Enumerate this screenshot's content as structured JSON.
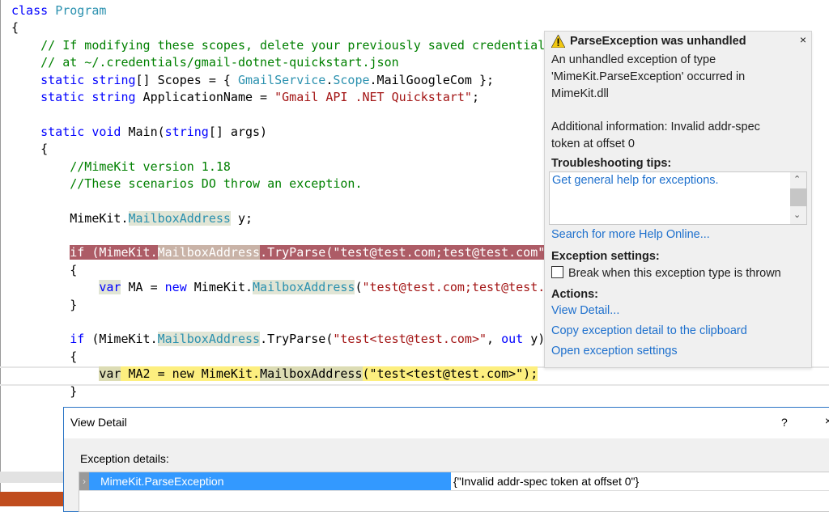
{
  "editor": {
    "lines": [
      [
        [
          "class ",
          "kw"
        ],
        [
          "Program",
          "ty"
        ]
      ],
      [
        [
          "{",
          "pl"
        ]
      ],
      [
        [
          "    ",
          "pl"
        ],
        [
          "// If modifying these scopes, delete your previously saved credentials",
          "cm"
        ]
      ],
      [
        [
          "    ",
          "pl"
        ],
        [
          "// at ~/.credentials/gmail-dotnet-quickstart.json",
          "cm"
        ]
      ],
      [
        [
          "    ",
          "pl"
        ],
        [
          "static string",
          "kw"
        ],
        [
          "[] Scopes = { ",
          "pl"
        ],
        [
          "GmailService",
          "ty"
        ],
        [
          ".",
          "pl"
        ],
        [
          "Scope",
          "ty"
        ],
        [
          ".MailGoogleCom };",
          "pl"
        ]
      ],
      [
        [
          "    ",
          "pl"
        ],
        [
          "static string",
          "kw"
        ],
        [
          " ApplicationName = ",
          "pl"
        ],
        [
          "\"Gmail API .NET Quickstart\"",
          "st"
        ],
        [
          ";",
          "pl"
        ]
      ],
      [],
      [
        [
          "    ",
          "pl"
        ],
        [
          "static void",
          "kw"
        ],
        [
          " Main(",
          "pl"
        ],
        [
          "string",
          "kw"
        ],
        [
          "[] args)",
          "pl"
        ]
      ],
      [
        [
          "    {",
          "pl"
        ]
      ],
      [
        [
          "        ",
          "pl"
        ],
        [
          "//MimeKit version 1.18",
          "cm"
        ]
      ],
      [
        [
          "        ",
          "pl"
        ],
        [
          "//These scenarios DO throw an exception.",
          "cm"
        ]
      ],
      [],
      [
        [
          "        MimeKit.",
          "pl"
        ],
        [
          "MailboxAddress",
          "ty hl-ref"
        ],
        [
          " y;",
          "pl"
        ]
      ],
      [],
      [
        [
          "        ",
          "pl"
        ],
        [
          "if (MimeKit.",
          "hl-err"
        ],
        [
          "MailboxAddress",
          "hl-errref"
        ],
        [
          ".TryParse(\"test@test.com;test@test.com\"",
          "hl-err"
        ]
      ],
      [
        [
          "        {",
          "pl"
        ]
      ],
      [
        [
          "            ",
          "pl"
        ],
        [
          "var",
          "kw hl-ref"
        ],
        [
          " MA = ",
          "pl"
        ],
        [
          "new",
          "kw"
        ],
        [
          " MimeKit.",
          "pl"
        ],
        [
          "MailboxAddress",
          "ty hl-ref"
        ],
        [
          "(",
          "pl"
        ],
        [
          "\"test@test.com;test@test.com\"",
          "st"
        ]
      ],
      [
        [
          "        }",
          "pl"
        ]
      ],
      [],
      [
        [
          "        ",
          "pl"
        ],
        [
          "if",
          "kw"
        ],
        [
          " (MimeKit.",
          "pl"
        ],
        [
          "MailboxAddress",
          "ty hl-ref"
        ],
        [
          ".TryParse(",
          "pl"
        ],
        [
          "\"test<test@test.com>\"",
          "st"
        ],
        [
          ", ",
          "pl"
        ],
        [
          "out",
          "kw"
        ],
        [
          " y);",
          "pl"
        ]
      ],
      [
        [
          "        {",
          "pl"
        ]
      ],
      [
        [
          "            ",
          "pl"
        ],
        [
          "var",
          "hl-curref"
        ],
        [
          " MA2 = new MimeKit.",
          "hl-cur"
        ],
        [
          "MailboxAddress",
          "hl-curref"
        ],
        [
          "(\"test<test@test.com>\");",
          "hl-cur"
        ]
      ],
      [
        [
          "        }",
          "pl"
        ]
      ]
    ]
  },
  "exception_popup": {
    "title": "ParseException was unhandled",
    "close": "×",
    "message_lines": [
      "An unhandled exception of type",
      "'MimeKit.ParseException' occurred in",
      "MimeKit.dll"
    ],
    "additional_lines": [
      "Additional information: Invalid addr-spec",
      "token at offset 0"
    ],
    "tips_heading": "Troubleshooting tips:",
    "tip_link": "Get general help for exceptions.",
    "search_link": "Search for more Help Online...",
    "settings_heading": "Exception settings:",
    "break_checkbox": {
      "label": "Break when this exception type is thrown",
      "checked": false
    },
    "actions_heading": "Actions:",
    "actions": [
      "View Detail...",
      "Copy exception detail to the clipboard",
      "Open exception settings"
    ],
    "link_color": "#1e70cd"
  },
  "view_detail": {
    "title": "View Detail",
    "help": "?",
    "close": "×",
    "label": "Exception details:",
    "row": {
      "name": "MimeKit.ParseException",
      "value": "{\"Invalid addr-spec token at offset 0\"}",
      "expander": "›"
    }
  }
}
